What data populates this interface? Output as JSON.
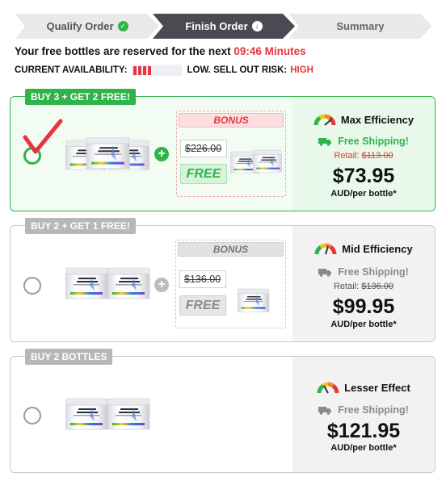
{
  "stepper": {
    "steps": [
      {
        "label": "Qualify Order",
        "state": "done"
      },
      {
        "label": "Finish Order",
        "state": "active"
      },
      {
        "label": "Summary",
        "state": "pending"
      }
    ]
  },
  "reserve": {
    "text": "Your free bottles are reserved for the next",
    "timer": "09:46 Minutes"
  },
  "availability": {
    "label": "CURRENT AVAILABILITY:",
    "level_fraction": 0.2,
    "risk_label": "LOW. SELL OUT RISK:",
    "risk_value": "HIGH"
  },
  "colors": {
    "green": "#2fb34a",
    "red": "#e8343c",
    "dark_step": "#4a4b52"
  },
  "offers": [
    {
      "tag": "BUY 3 + GET 2 FREE!",
      "selected": true,
      "bonus_title": "BONUS",
      "bonus_old_price": "$226.00",
      "bonus_free": "FREE",
      "efficiency": "Max Efficiency",
      "shipping": "Free Shipping!",
      "retail_label": "Retail:",
      "retail_price": "$113.00",
      "price": "$73.95",
      "per": "AUD/per bottle*"
    },
    {
      "tag": "BUY 2 + GET 1 FREE!",
      "selected": false,
      "bonus_title": "BONUS",
      "bonus_old_price": "$136.00",
      "bonus_free": "FREE",
      "efficiency": "Mid Efficiency",
      "shipping": "Free Shipping!",
      "retail_label": "Retail:",
      "retail_price": "$136.00",
      "price": "$99.95",
      "per": "AUD/per bottle*"
    },
    {
      "tag": "BUY 2 BOTTLES",
      "selected": false,
      "efficiency": "Lesser Effect",
      "shipping": "Free Shipping!",
      "price": "$121.95",
      "per": "AUD/per bottle*"
    }
  ]
}
